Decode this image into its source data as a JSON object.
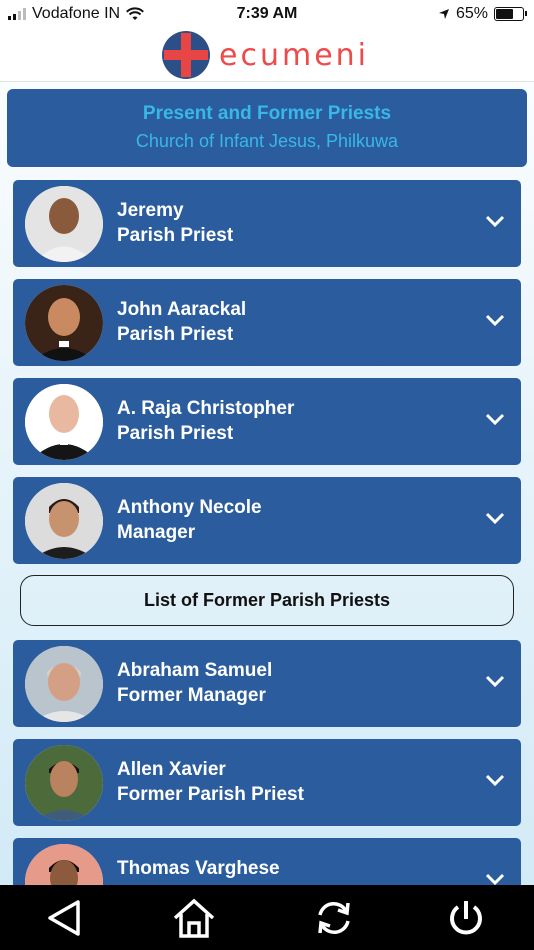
{
  "status_bar": {
    "carrier": "Vodafone IN",
    "time": "7:39 AM",
    "battery": "65%",
    "battery_level": 0.65
  },
  "header": {
    "brand": "ecumeni"
  },
  "banner": {
    "title": "Present and Former Priests",
    "subtitle": "Church of Infant Jesus, Philkuwa"
  },
  "current_priests": [
    {
      "name": "Jeremy",
      "role": "Parish Priest"
    },
    {
      "name": "John Aarackal",
      "role": "Parish Priest"
    },
    {
      "name": "A. Raja Christopher",
      "role": "Parish Priest"
    },
    {
      "name": "Anthony Necole",
      "role": "Manager"
    }
  ],
  "former_button": {
    "label": "List of Former Parish Priests"
  },
  "former_priests": [
    {
      "name": "Abraham Samuel",
      "role": "Former Manager"
    },
    {
      "name": "Allen Xavier",
      "role": "Former Parish Priest"
    },
    {
      "name": "Thomas Varghese",
      "role": ""
    }
  ],
  "colors": {
    "card": "#2b5d9e",
    "banner_text": "#38b7e8",
    "brand": "#ee4a4a"
  },
  "icons": [
    "wifi-icon",
    "location-arrow-icon",
    "chevron-down-icon",
    "back-icon",
    "home-icon",
    "refresh-icon",
    "power-icon"
  ]
}
